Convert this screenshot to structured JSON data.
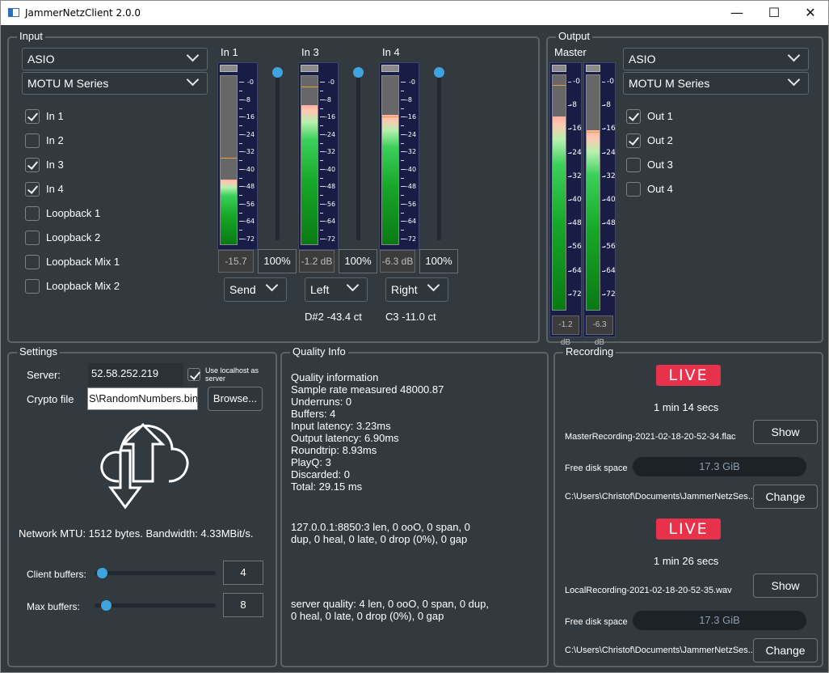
{
  "window": {
    "title": "JammerNetzClient 2.0.0",
    "minimize": "—",
    "maximize": "☐",
    "close": "✕"
  },
  "input": {
    "title": "Input",
    "device_type": "ASIO",
    "device": "MOTU M Series",
    "channels": [
      {
        "label": "In 1",
        "checked": true
      },
      {
        "label": "In 2",
        "checked": false
      },
      {
        "label": "In 3",
        "checked": true
      },
      {
        "label": "In 4",
        "checked": true
      },
      {
        "label": "Loopback 1",
        "checked": false
      },
      {
        "label": "Loopback 2",
        "checked": false
      },
      {
        "label": "Loopback Mix 1",
        "checked": false
      },
      {
        "label": "Loopback Mix 2",
        "checked": false
      }
    ],
    "strips": [
      {
        "name": "In 1",
        "level_db": "-15.7 dB",
        "volume": "100%",
        "target": "Send",
        "level_fraction": 0.38,
        "peak_fraction": 0.52,
        "tuner": ""
      },
      {
        "name": "In 3",
        "level_db": "-1.2 dB",
        "volume": "100%",
        "target": "Left",
        "level_fraction": 0.82,
        "peak_fraction": 0.94,
        "tuner": "D#2 -43.4 ct"
      },
      {
        "name": "In 4",
        "level_db": "-6.3 dB",
        "volume": "100%",
        "target": "Right",
        "level_fraction": 0.76,
        "peak_fraction": 0.76,
        "tuner": "C3 -11.0 ct"
      }
    ],
    "scale_labels": [
      "-0",
      "-8",
      "-16",
      "-24",
      "-32",
      "-40",
      "-48",
      "-56",
      "-64",
      "-72"
    ]
  },
  "output": {
    "title": "Output",
    "master_label": "Master",
    "device_type": "ASIO",
    "device": "MOTU M Series",
    "channels": [
      {
        "label": "Out 1",
        "checked": true
      },
      {
        "label": "Out 2",
        "checked": true
      },
      {
        "label": "Out 3",
        "checked": false
      },
      {
        "label": "Out 4",
        "checked": false
      }
    ],
    "meters": [
      {
        "level_db": "-1.2 dB",
        "level_fraction": 0.82,
        "peak_fraction": 0.96
      },
      {
        "level_db": "-6.3 dB",
        "level_fraction": 0.76,
        "peak_fraction": 0.76
      }
    ]
  },
  "settings": {
    "title": "Settings",
    "server_label": "Server:",
    "server_value": "52.58.252.219",
    "use_localhost_label": "Use localhost as server",
    "use_localhost_checked": true,
    "crypto_label": "Crypto file",
    "crypto_value": "S\\RandomNumbers.bin",
    "browse_label": "Browse...",
    "network_text": "Network MTU: 1512 bytes. Bandwidth: 4.33MBit/s.",
    "client_buffers_label": "Client buffers:",
    "client_buffers_value": "4",
    "client_buffers_fraction": 0.06,
    "max_buffers_label": "Max buffers:",
    "max_buffers_value": "8",
    "max_buffers_fraction": 0.09
  },
  "quality": {
    "title": "Quality Info",
    "info": "Quality information\nSample rate measured 48000.87\nUnderruns: 0\nBuffers: 4\nInput latency: 3.23ms\nOutput latency: 6.90ms\nRoundtrip: 8.93ms\nPlayQ: 3\nDiscarded: 0\nTotal: 29.15 ms",
    "client": "127.0.0.1:8850:3 len, 0 ooO, 0 span, 0\ndup, 0 heal, 0 late, 0 drop (0%), 0 gap",
    "server": "server quality: 4 len, 0 ooO, 0 span, 0 dup,\n0 heal, 0 late, 0 drop (0%), 0 gap"
  },
  "recording": {
    "title": "Recording",
    "items": [
      {
        "badge": "LIVE",
        "duration": "1 min 14 secs",
        "file": "MasterRecording-2021-02-18-20-52-34.flac",
        "show_label": "Show",
        "disk_label": "Free disk space",
        "disk_value": "17.3 GiB",
        "path": "C:\\Users\\Christof\\Documents\\JammerNetzSes...",
        "change_label": "Change"
      },
      {
        "badge": "LIVE",
        "duration": "1 min 26 secs",
        "file": "LocalRecording-2021-02-18-20-52-35.wav",
        "show_label": "Show",
        "disk_label": "Free disk space",
        "disk_value": "17.3 GiB",
        "path": "C:\\Users\\Christof\\Documents\\JammerNetzSes...",
        "change_label": "Change"
      }
    ]
  }
}
